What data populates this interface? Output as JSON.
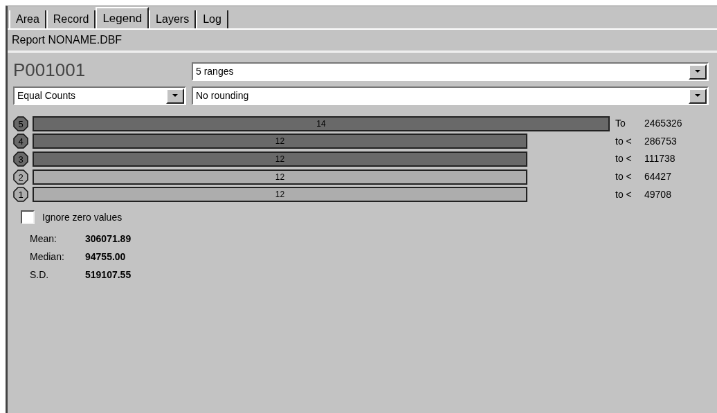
{
  "tabs": [
    {
      "label": "Area",
      "selected": false
    },
    {
      "label": "Record",
      "selected": false
    },
    {
      "label": "Legend",
      "selected": true
    },
    {
      "label": "Layers",
      "selected": false
    },
    {
      "label": "Log",
      "selected": false
    }
  ],
  "report_title": "Report NONAME.DBF",
  "field_name": "P001001",
  "ranges_dropdown": {
    "value": "5 ranges"
  },
  "method_dropdown": {
    "value": "Equal Counts"
  },
  "rounding_dropdown": {
    "value": "No rounding"
  },
  "ranges": [
    {
      "number": "5",
      "count": "14",
      "color": "#696969",
      "prefix": "To",
      "limit": "2465326"
    },
    {
      "number": "4",
      "count": "12",
      "color": "#696969",
      "prefix": "to <",
      "limit": "286753"
    },
    {
      "number": "3",
      "count": "12",
      "color": "#696969",
      "prefix": "to <",
      "limit": "111738"
    },
    {
      "number": "2",
      "count": "12",
      "color": "#adadad",
      "prefix": "to <",
      "limit": "64427"
    },
    {
      "number": "1",
      "count": "12",
      "color": "#adadad",
      "prefix": "to <",
      "limit": "49708"
    }
  ],
  "ignore_zero": {
    "label": "Ignore zero values",
    "checked": false
  },
  "stats": [
    {
      "label": "Mean:",
      "value": "306071.89"
    },
    {
      "label": "Median:",
      "value": "94755.00"
    },
    {
      "label": "S.D.",
      "value": "519107.55"
    }
  ]
}
